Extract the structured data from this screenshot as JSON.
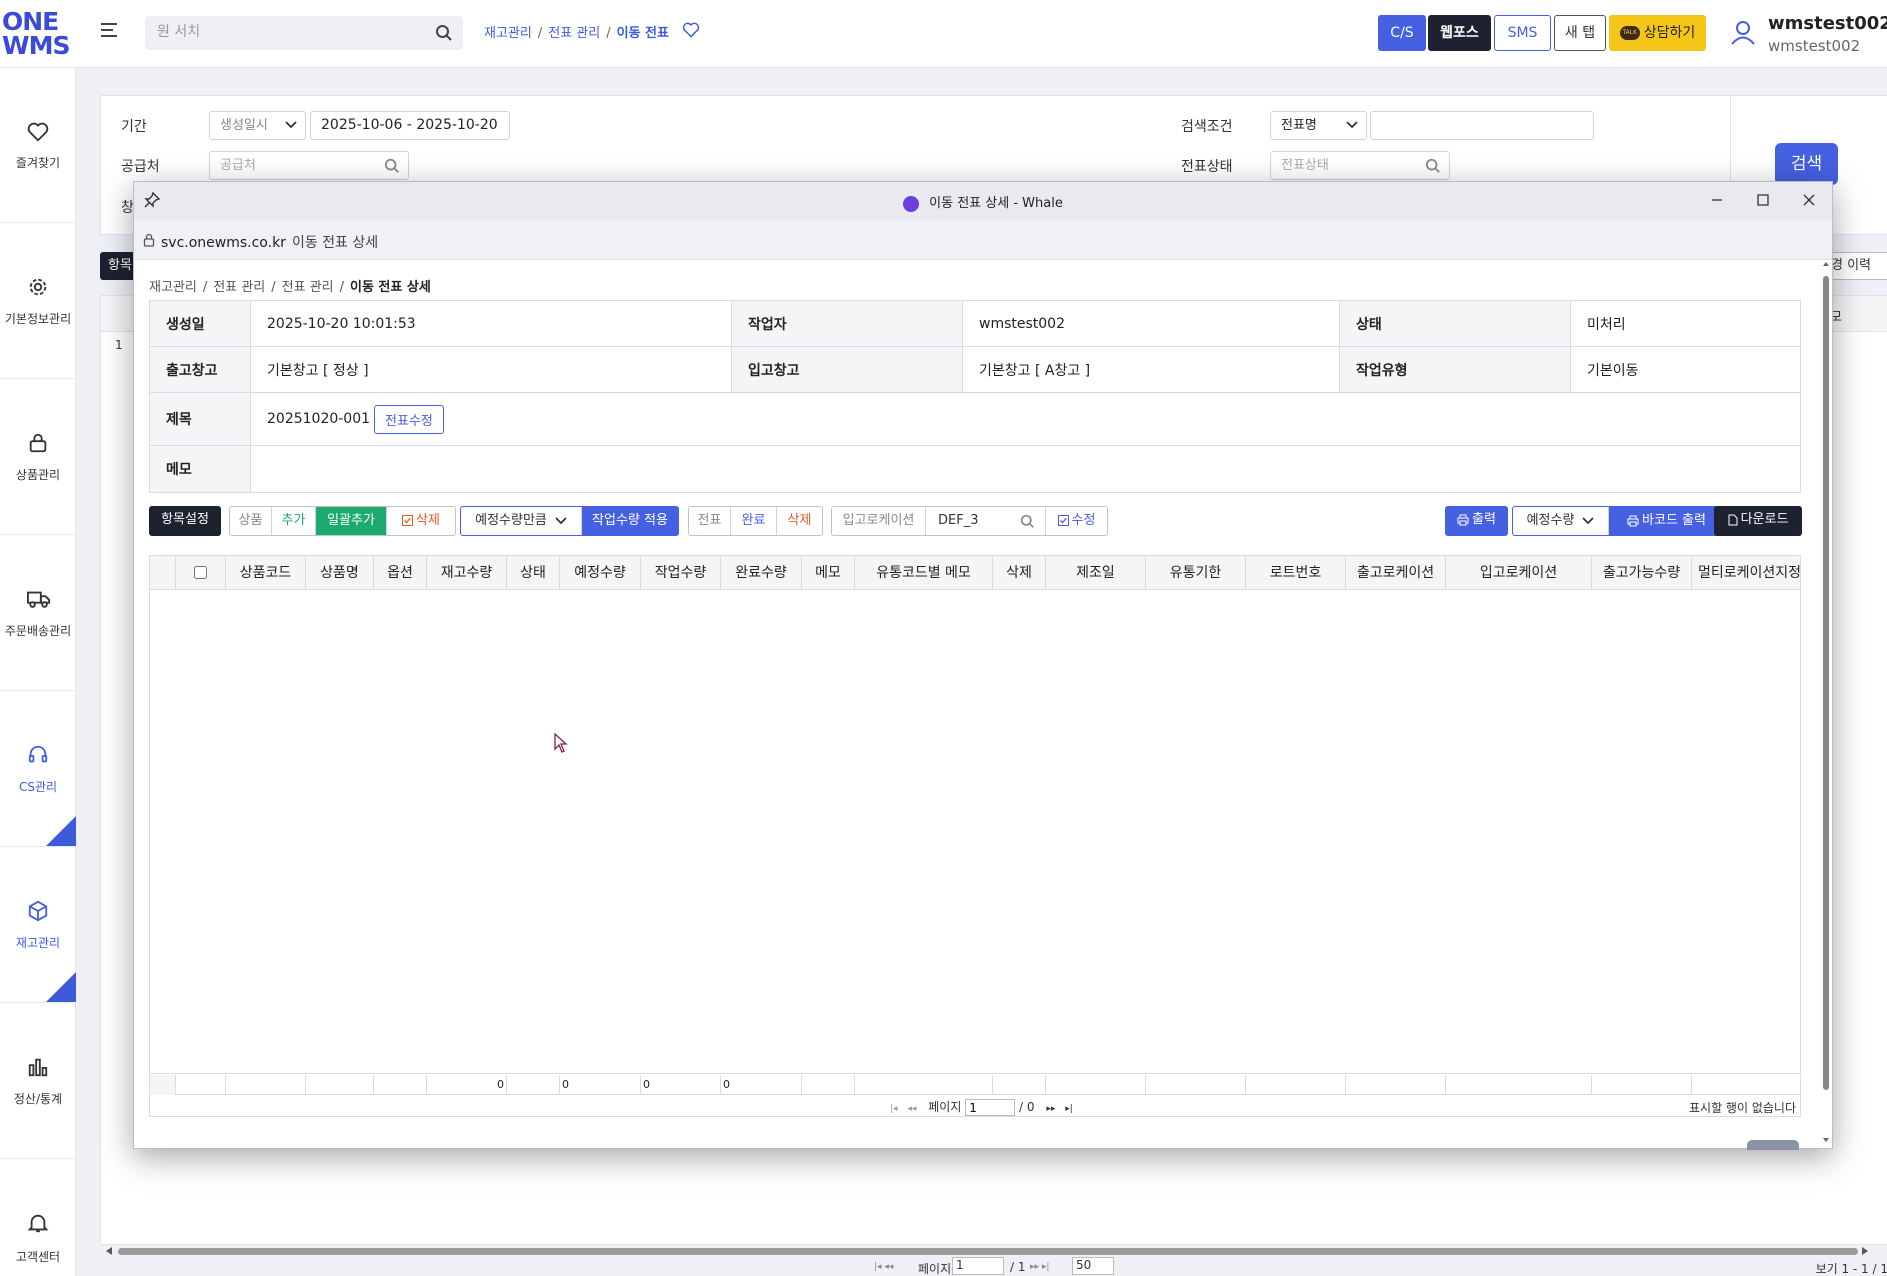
{
  "topbar": {
    "logo_line1": "ONE",
    "logo_line2": "WMS",
    "search_placeholder": "원 서치",
    "breadcrumb": [
      "재고관리",
      "전표 관리",
      "이동 전표"
    ],
    "buttons": {
      "cs": "C/S",
      "webpos": "웹포스",
      "sms": "SMS",
      "newtab": "새 탭",
      "consult": "상담하기"
    },
    "consult_badge": "TALK",
    "user_name": "wmstest002",
    "user_id": "wmstest002"
  },
  "sidebar": {
    "items": [
      {
        "label": "즐겨찾기",
        "icon": "heart-icon"
      },
      {
        "label": "기본정보관리",
        "icon": "gear-icon"
      },
      {
        "label": "상품관리",
        "icon": "lock-icon"
      },
      {
        "label": "주문배송관리",
        "icon": "truck-icon"
      },
      {
        "label": "CS관리",
        "icon": "headset-icon"
      },
      {
        "label": "재고관리",
        "icon": "box-icon"
      },
      {
        "label": "정산/통계",
        "icon": "bar-chart-icon"
      },
      {
        "label": "고객센터",
        "icon": "bell-icon"
      }
    ],
    "active": "재고관리"
  },
  "background": {
    "period_label": "기간",
    "period_type": "생성일시",
    "period_value": "2025-10-06 - 2025-10-20",
    "supplier_label": "공급처",
    "supplier_placeholder": "공급처",
    "search_cond_label": "검색조건",
    "search_cond_value": "전표명",
    "slip_status_label": "전표상태",
    "slip_status_placeholder": "전표상태",
    "third_row_label_partial": "창",
    "search_button": "검색",
    "items_button_partial": "항목",
    "history_button_partial": "경 이력",
    "row1": "1",
    "memo_col_partial": "모",
    "pager": {
      "page_label": "페이지",
      "page_value": "1",
      "page_total": "/ 1",
      "rows": "50",
      "view_info": "보기 1 - 1 / 1"
    }
  },
  "popup": {
    "window_title": "이동 전표 상세 - Whale",
    "url_host": "svc.onewms.co.kr",
    "url_title": "이동 전표 상세",
    "breadcrumb": [
      "재고관리",
      "전표 관리",
      "전표 관리",
      "이동 전표 상세"
    ],
    "detail": {
      "created_label": "생성일",
      "created_value": "2025-10-20 10:01:53",
      "worker_label": "작업자",
      "worker_value": "wmstest002",
      "status_label": "상태",
      "status_value": "미처리",
      "out_wh_label": "출고창고",
      "out_wh_value": "기본창고 [ 정상 ]",
      "in_wh_label": "입고창고",
      "in_wh_value": "기본창고 [ A창고 ]",
      "work_type_label": "작업유형",
      "work_type_value": "기본이동",
      "title_label": "제목",
      "title_value": "20251020-001",
      "edit_slip_button": "전표수정",
      "memo_label": "메모",
      "memo_value": ""
    },
    "toolbar": {
      "items_setting": "항목설정",
      "product_group_label": "상품",
      "add": "추가",
      "bulk_add": "일괄추가",
      "delete": "삭제",
      "qty_select": "예정수량만큼",
      "apply_work_qty": "작업수량 적용",
      "slip_group_label": "전표",
      "complete": "완료",
      "slip_delete": "삭제",
      "in_location_label": "입고로케이션",
      "in_location_value": "DEF_3",
      "modify": "수정",
      "print": "출력",
      "qty_type": "예정수량",
      "barcode_print": "바코드 출력",
      "download": "다운로드"
    },
    "grid": {
      "columns": [
        "상품코드",
        "상품명",
        "옵션",
        "재고수량",
        "상태",
        "예정수량",
        "작업수량",
        "완료수량",
        "메모",
        "유통코드별 메모",
        "삭제",
        "제조일",
        "유통기한",
        "로트번호",
        "출고로케이션",
        "입고로케이션",
        "출고가능수량",
        "멀티로케이션지정"
      ],
      "totals": {
        "stock": "0",
        "planned": "0",
        "work": "0",
        "done": "0"
      },
      "pager": {
        "page_label": "페이지",
        "page_value": "1",
        "page_total": "/ 0",
        "empty_message": "표시할 행이 없습니다"
      }
    }
  },
  "colors": {
    "accent": "#4560e0",
    "dark": "#1d2230",
    "green": "#1bab6f",
    "yellow": "#f5c518",
    "delete_red": "#e05a2b"
  }
}
